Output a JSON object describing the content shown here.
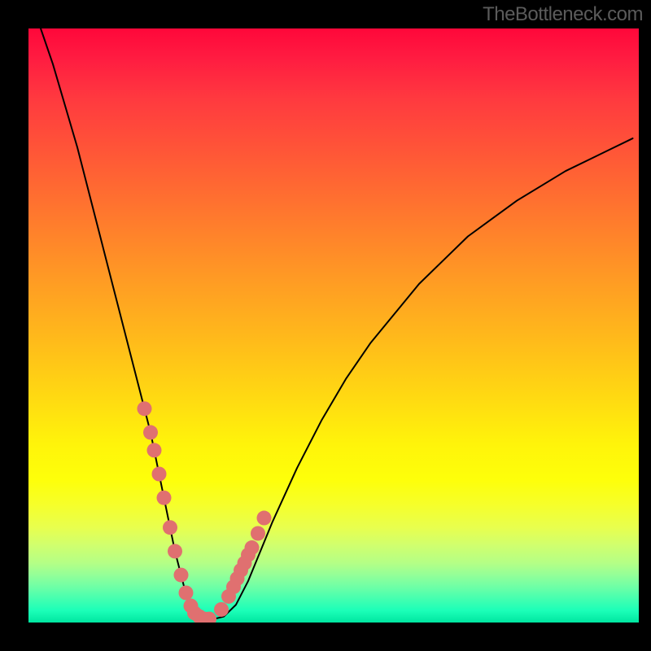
{
  "watermark": "TheBottleneck.com",
  "chart_data": {
    "type": "line",
    "title": "",
    "xlabel": "",
    "ylabel": "",
    "xlim": [
      0,
      100
    ],
    "ylim": [
      0,
      100
    ],
    "curve": {
      "x": [
        2,
        4,
        6,
        8,
        10,
        12,
        14,
        16,
        18,
        20,
        22,
        23,
        24,
        25,
        26,
        27,
        28,
        29,
        30,
        32,
        34,
        36,
        38,
        40,
        44,
        48,
        52,
        56,
        60,
        64,
        68,
        72,
        76,
        80,
        84,
        88,
        92,
        96,
        99
      ],
      "y": [
        100,
        94,
        87,
        80,
        72,
        64,
        56,
        48,
        40,
        32,
        22,
        17,
        12,
        8,
        4,
        2,
        1,
        0.5,
        0.5,
        1,
        3,
        7,
        12,
        17,
        26,
        34,
        41,
        47,
        52,
        57,
        61,
        65,
        68,
        71,
        73.5,
        76,
        78,
        80,
        81.5
      ]
    },
    "markers": {
      "x": [
        19.0,
        20.0,
        20.6,
        21.4,
        22.2,
        23.2,
        24.0,
        25.0,
        25.8,
        26.6,
        27.2,
        28.0,
        28.8,
        29.6,
        31.6,
        32.8,
        33.6,
        34.2,
        34.8,
        35.4,
        36.0,
        36.6,
        37.6,
        38.6
      ],
      "y": [
        36.0,
        32.0,
        29.0,
        25.0,
        21.0,
        16.0,
        12.0,
        8.0,
        5.0,
        2.8,
        1.6,
        1.0,
        0.6,
        0.6,
        2.2,
        4.4,
        6.0,
        7.4,
        8.8,
        10.0,
        11.4,
        12.6,
        15.0,
        17.6
      ]
    },
    "marker_radius_px": 9,
    "gradient": [
      "#ff073a",
      "#ff7a2d",
      "#fff40a",
      "#feff0a",
      "#44ffb0",
      "#00e6a0"
    ]
  }
}
